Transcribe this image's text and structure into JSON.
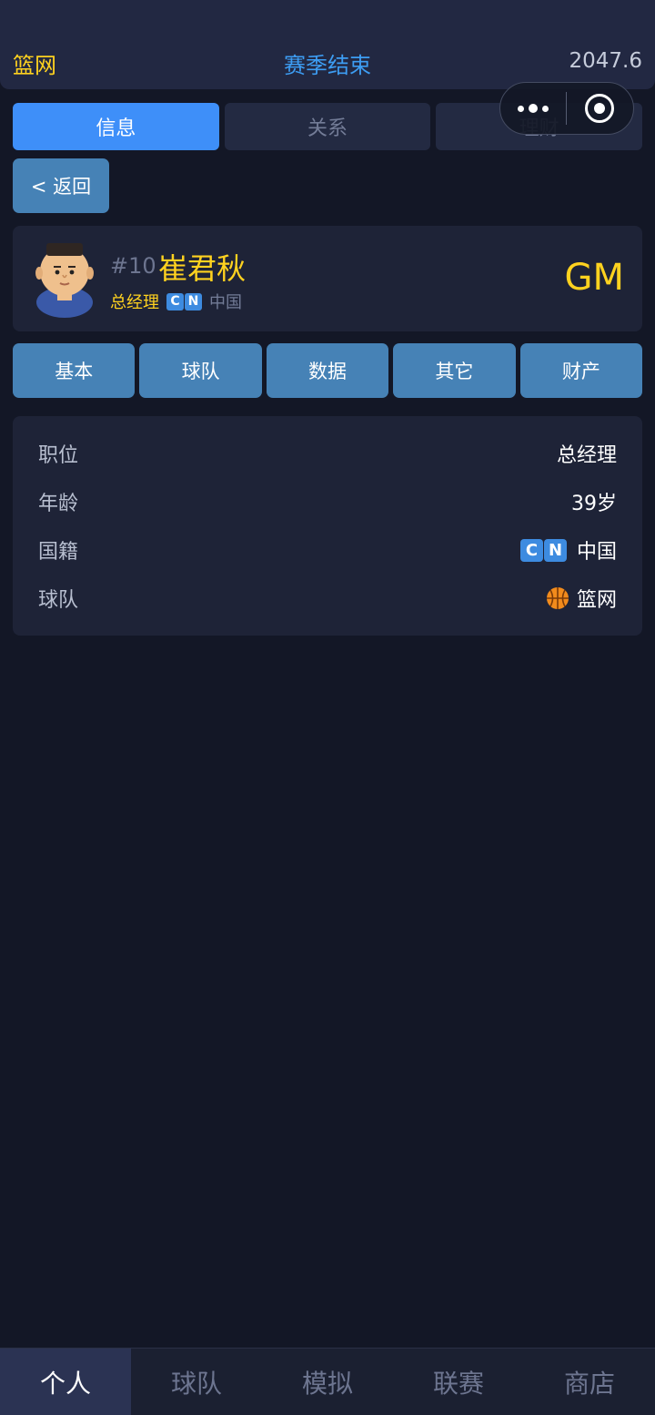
{
  "header": {
    "team": "篮网",
    "season_status": "赛季结束",
    "money": "2047.6"
  },
  "tabs": [
    {
      "label": "信息",
      "active": true
    },
    {
      "label": "关系",
      "active": false
    },
    {
      "label": "理财",
      "active": false
    }
  ],
  "back_label": "< 返回",
  "profile": {
    "number": "#10",
    "name": "崔君秋",
    "role": "总经理",
    "flag_letters": [
      "C",
      "N"
    ],
    "country": "中国",
    "badge": "GM"
  },
  "subtabs": [
    "基本",
    "球队",
    "数据",
    "其它",
    "财产"
  ],
  "info": {
    "position_label": "职位",
    "position_value": "总经理",
    "age_label": "年龄",
    "age_value": "39岁",
    "nationality_label": "国籍",
    "nationality_value": "中国",
    "team_label": "球队",
    "team_value": "篮网"
  },
  "bottom_nav": [
    {
      "label": "个人",
      "active": true
    },
    {
      "label": "球队",
      "active": false
    },
    {
      "label": "模拟",
      "active": false
    },
    {
      "label": "联赛",
      "active": false
    },
    {
      "label": "商店",
      "active": false
    }
  ],
  "colors": {
    "accent_yellow": "#ffd21f",
    "accent_blue": "#3e8ff9",
    "button_blue": "#4682b6",
    "background": "#131726",
    "card": "#1e2337"
  },
  "icons": {
    "team_logo": "basketball-icon",
    "avatar": "avatar",
    "capsule_more": "more-dots-icon",
    "capsule_close": "target-circle-icon"
  }
}
